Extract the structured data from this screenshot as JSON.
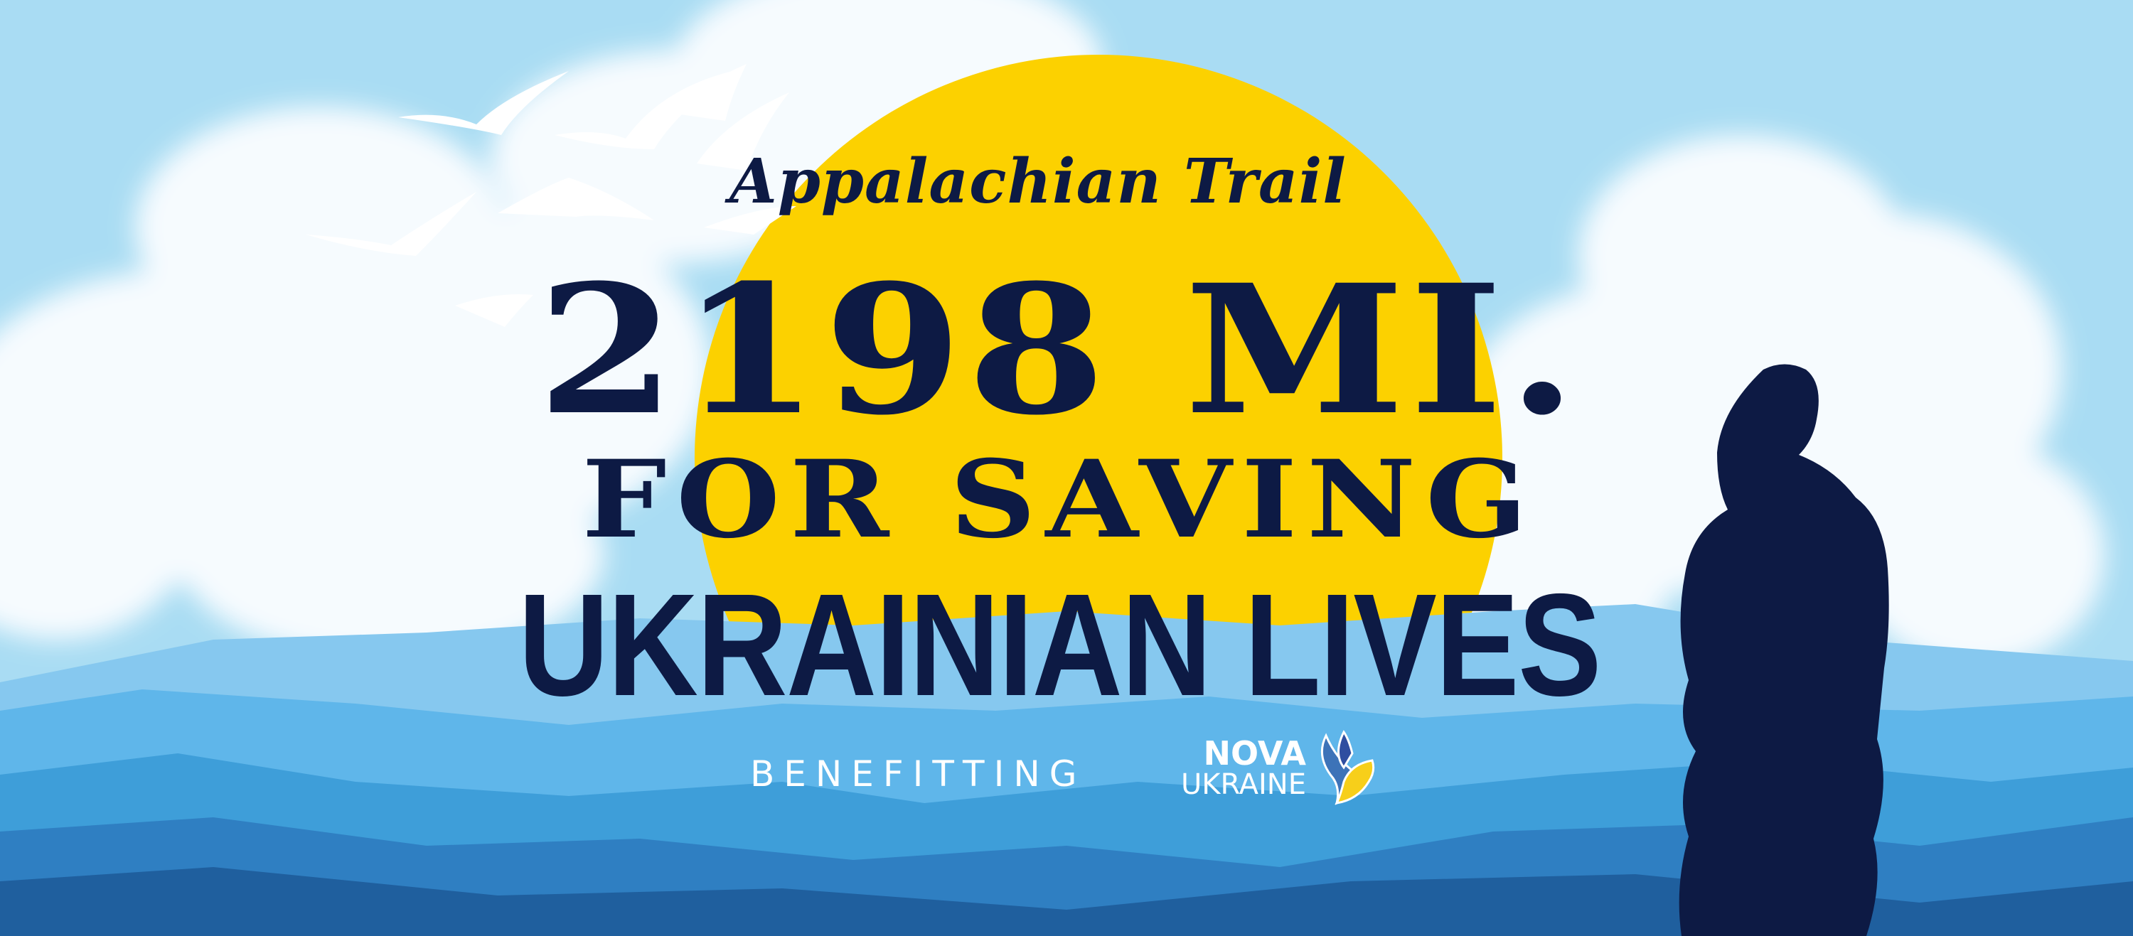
{
  "banner": {
    "script_title": "Appalachian Trail",
    "headline": "2198 MI.",
    "line2": "FOR SAVING",
    "line3": "UKRAINIAN LIVES",
    "benefitting": "BENEFITTING",
    "logo": {
      "name_top": "NOVA",
      "name_bottom": "UKRAINE",
      "icon": "dove-icon"
    }
  },
  "colors": {
    "sky": "#a9dcf3",
    "sun": "#fcd100",
    "text": "#0d1a44",
    "mountain_light": "#5fb6ea",
    "mountain_dark": "#1f5f9e",
    "logo_blue": "#2f4ea0",
    "logo_yellow": "#f7cf1a"
  }
}
